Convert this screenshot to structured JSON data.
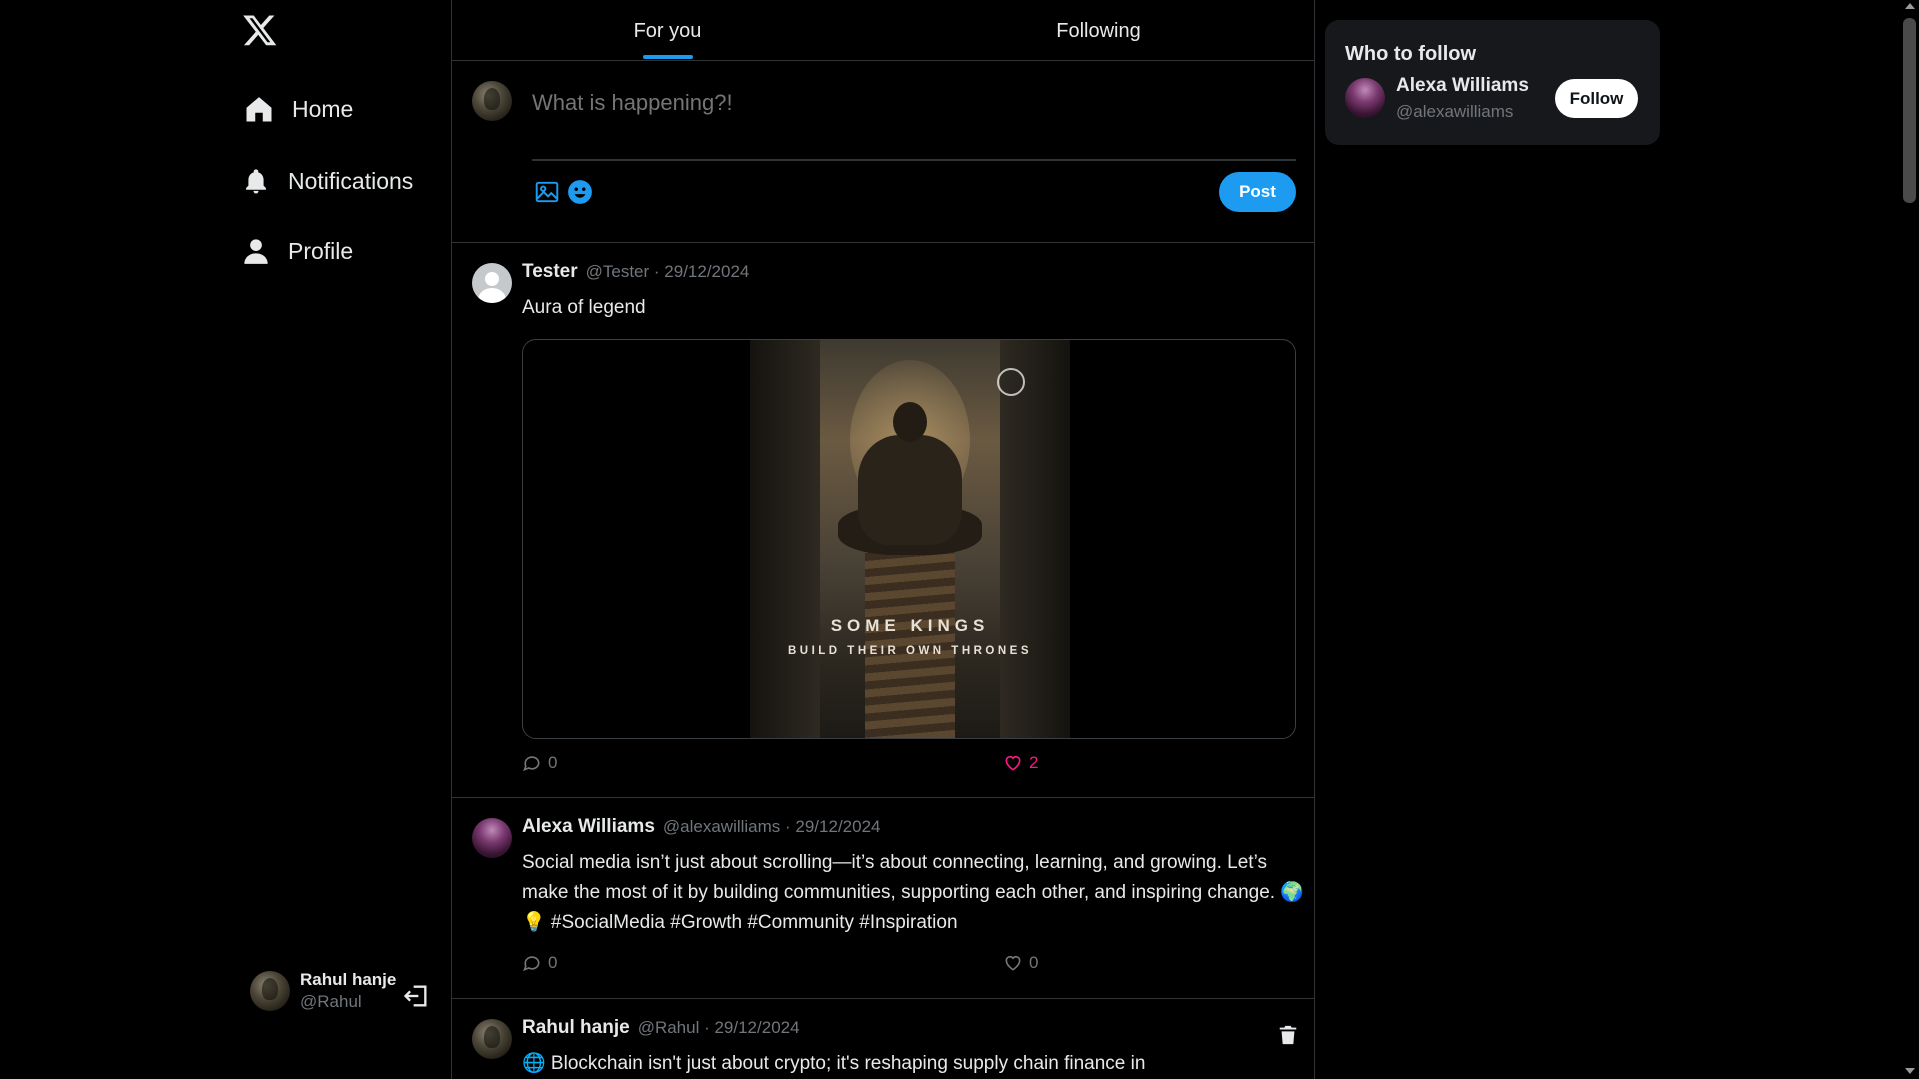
{
  "sidebar": {
    "logo_icon": "x-logo-icon",
    "nav": [
      {
        "label": "Home",
        "icon": "home-icon"
      },
      {
        "label": "Notifications",
        "icon": "bell-icon"
      },
      {
        "label": "Profile",
        "icon": "person-icon"
      }
    ],
    "account": {
      "name": "Rahul hanje",
      "handle": "@Rahul",
      "logout_icon": "logout-icon"
    }
  },
  "tabs": [
    {
      "label": "For you",
      "active": true
    },
    {
      "label": "Following",
      "active": false
    }
  ],
  "composer": {
    "placeholder": "What is happening?!",
    "post_label": "Post",
    "icons": [
      "image-icon",
      "emoji-icon"
    ]
  },
  "feed": [
    {
      "name": "Tester",
      "meta": "@Tester · 29/12/2024",
      "text": "Aura of legend",
      "media": {
        "title": "SOME KINGS",
        "subtitle": "BUILD THEIR OWN THRONES"
      },
      "comments": "0",
      "likes": "2",
      "liked": true
    },
    {
      "name": "Alexa Williams",
      "meta": "@alexawilliams · 29/12/2024",
      "text": "Social media isn’t just about scrolling—it’s about connecting, learning, and growing. Let’s make the most of it by building communities, supporting each other, and inspiring change. 🌍 💡  #SocialMedia #Growth #Community #Inspiration",
      "comments": "0",
      "likes": "0",
      "liked": false
    },
    {
      "name": "Rahul hanje",
      "meta": "@Rahul · 29/12/2024",
      "text": "🌐 Blockchain isn't just about crypto; it's reshaping supply chain finance in",
      "delete_icon": "trash-icon"
    }
  ],
  "who_to_follow": {
    "title": "Who to follow",
    "name": "Alexa Williams",
    "handle": "@alexawilliams",
    "follow_label": "Follow"
  },
  "colors": {
    "accent": "#1d9bf0",
    "like": "#f91880",
    "muted": "#71767b",
    "border": "#2f3336"
  }
}
